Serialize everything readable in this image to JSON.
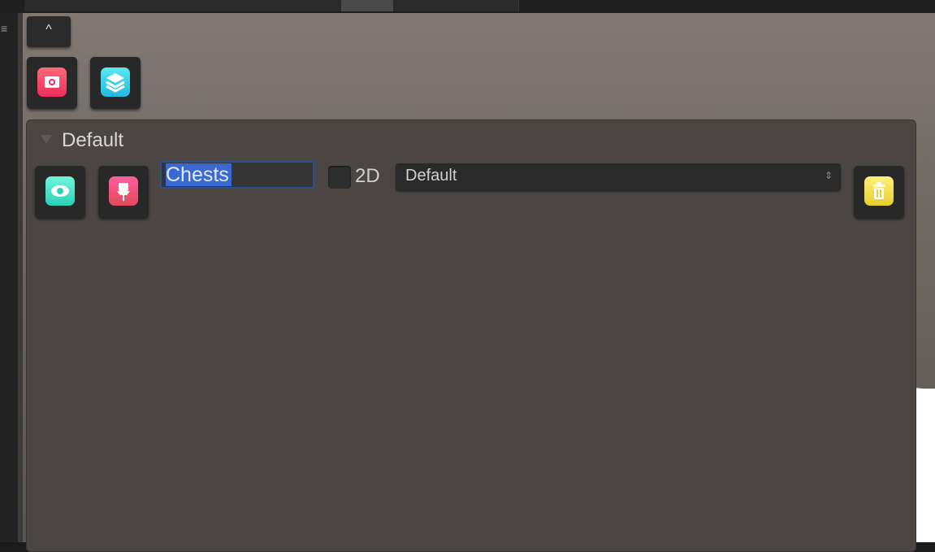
{
  "toolbar": {
    "collapse_label": "^",
    "buttons": [
      {
        "icon": "camera-icon",
        "color": "#ee2b5b"
      },
      {
        "icon": "layers-icon",
        "color": "#24b8e0"
      }
    ]
  },
  "group": {
    "title": "Default",
    "expanded": true,
    "visibility_icon": "eye-icon",
    "pin_icon": "pin-icon",
    "name_value": "Chests",
    "is_2d_checked": false,
    "label_2d": "2D",
    "layer_dropdown": {
      "selected": "Default",
      "chevron": "⇕"
    },
    "delete_icon": "trash-icon"
  },
  "colors": {
    "panel_bg": "#4b4643",
    "selection": "#3a6ad1",
    "accent_red": "#ee2b5b",
    "accent_cyan": "#24b8e0",
    "accent_teal": "#2ccfb8",
    "accent_pink": "#e04a5a",
    "accent_yellow": "#e6cf2f"
  }
}
